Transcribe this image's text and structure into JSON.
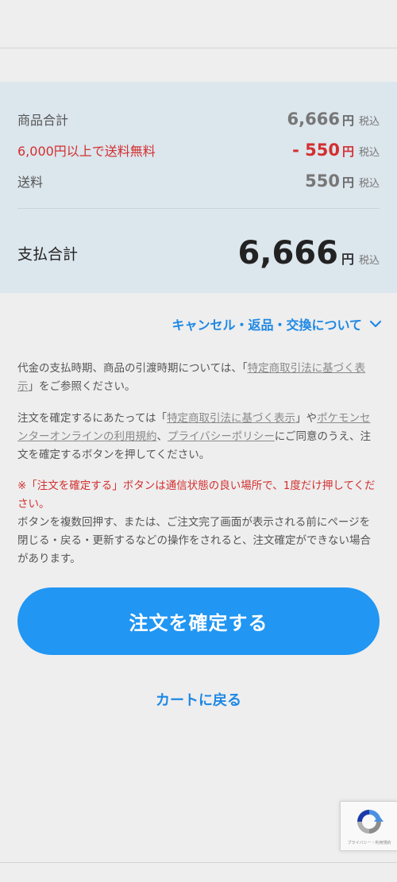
{
  "summary": {
    "rows": [
      {
        "label": "商品合計",
        "amount": "6,666",
        "yen": "円",
        "tax": "税込"
      },
      {
        "label": "6,000円以上で送料無料",
        "amount": "- 550",
        "yen": "円",
        "tax": "税込"
      },
      {
        "label": "送料",
        "amount": "550",
        "yen": "円",
        "tax": "税込"
      }
    ],
    "total": {
      "label": "支払合計",
      "amount": "6,666",
      "yen": "円",
      "tax": "税込"
    }
  },
  "accordion": {
    "label": "キャンセル・返品・交換について",
    "icon": "chevron-down-icon"
  },
  "notice": {
    "p1_a": "代金の支払時期、商品の引渡時期については、「",
    "p1_link": "特定商取引法に基づく表示",
    "p1_b": "」をご参照ください。",
    "p2_a": "注文を確定するにあたっては「",
    "p2_link1": "特定商取引法に基づく表示",
    "p2_b": "」や",
    "p2_link2": "ポケモンセンターオンラインの利用規約",
    "p2_c": "、",
    "p2_link3": "プライバシーポリシー",
    "p2_d": "にご同意のうえ、注文を確定するボタンを押してください。",
    "warning": "※「注文を確定する」ボタンは通信状態の良い場所で、1度だけ押してください。",
    "p3": "ボタンを複数回押す、または、ご注文完了画面が表示される前にページを閉じる・戻る・更新するなどの操作をされると、注文確定ができない場合があります。"
  },
  "actions": {
    "confirm_label": "注文を確定する",
    "back_label": "カートに戻る"
  },
  "recaptcha": {
    "text": "プライバシー・利用規約"
  },
  "colors": {
    "accent": "#2196f3",
    "link_blue": "#1e88e5",
    "warning_red": "#d32f2f",
    "summary_bg": "#dce6ed",
    "page_bg": "#eeeeee"
  }
}
